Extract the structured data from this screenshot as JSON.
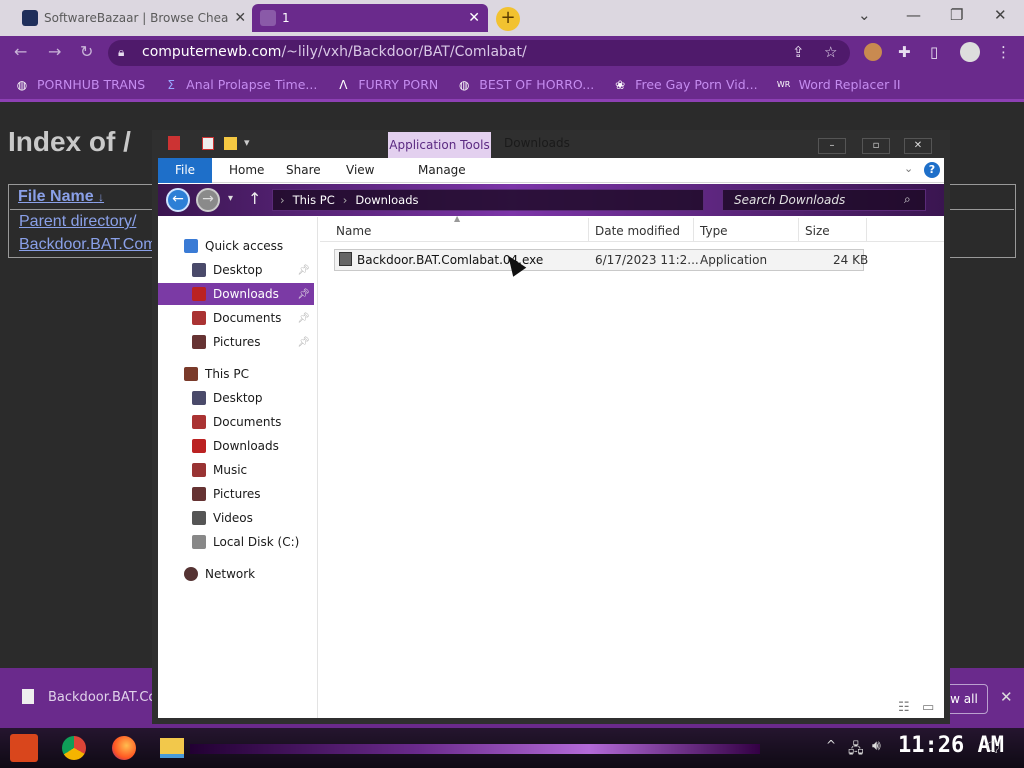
{
  "browser": {
    "tabs": [
      {
        "title": "SoftwareBazaar | Browse Chea",
        "active": false
      },
      {
        "title": "1",
        "active": true
      }
    ],
    "url_prefix": "computernewb.com",
    "url_rest": "/~lily/vxh/Backdoor/BAT/Comlabat/",
    "bookmarks": [
      {
        "label": "PORNHUB TRANS",
        "icon": "globe-icon"
      },
      {
        "label": "Anal Prolapse Time...",
        "icon": "bookmark-icon"
      },
      {
        "label": "FURRY PORN",
        "icon": "a-logo-icon"
      },
      {
        "label": "BEST OF HORRO...",
        "icon": "globe-icon"
      },
      {
        "label": "Free Gay Porn Vid...",
        "icon": "site-icon"
      },
      {
        "label": "Word Replacer II",
        "icon": "wr-icon"
      }
    ]
  },
  "page": {
    "title": "Index of /",
    "column_header": "File Name",
    "sort_indicator": "↓",
    "links": [
      "Parent directory/",
      "Backdoor.BAT.Com"
    ]
  },
  "download_shelf": {
    "file": "Backdoor.BAT.Co",
    "show_all": "w all"
  },
  "explorer": {
    "ribbon_context": "Application Tools",
    "window_title": "Downloads",
    "ribbon_tabs": [
      "File",
      "Home",
      "Share",
      "View",
      "Manage"
    ],
    "breadcrumb": [
      "This PC",
      "Downloads"
    ],
    "search_placeholder": "Search Downloads",
    "nav": {
      "quick_access": {
        "label": "Quick access",
        "items": [
          "Desktop",
          "Downloads",
          "Documents",
          "Pictures"
        ]
      },
      "this_pc": {
        "label": "This PC",
        "items": [
          "Desktop",
          "Documents",
          "Downloads",
          "Music",
          "Pictures",
          "Videos",
          "Local Disk (C:)"
        ]
      },
      "network": "Network"
    },
    "columns": [
      "Name",
      "Date modified",
      "Type",
      "Size"
    ],
    "files": [
      {
        "name": "Backdoor.BAT.Comlabat.04.exe",
        "date": "6/17/2023 11:2...",
        "type": "Application",
        "size": "24 KB"
      }
    ]
  },
  "taskbar": {
    "time": "11:26 AM"
  },
  "colors": {
    "browser_purple": "#6a2a8c",
    "selection": "#7b3aa5",
    "link": "#8aa0e8"
  }
}
